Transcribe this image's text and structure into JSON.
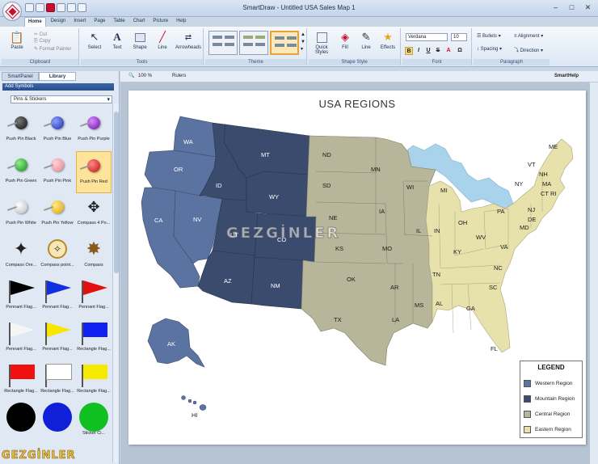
{
  "window": {
    "title": "SmartDraw - Untitled USA Sales Map 1"
  },
  "tabs": [
    "Home",
    "Design",
    "Insert",
    "Page",
    "Table",
    "Chart",
    "Picture",
    "Help"
  ],
  "ribbon": {
    "clipboard": {
      "paste": "Paste",
      "cut": "Cut",
      "copy": "Copy",
      "format_painter": "Format Painter",
      "label": "Clipboard"
    },
    "tools": {
      "select": "Select",
      "text": "Text",
      "shape": "Shape",
      "line": "Line",
      "arrowheads": "Arrowheads",
      "label": "Tools"
    },
    "theme": {
      "label": "Theme"
    },
    "shape_style": {
      "quick_styles": "Quick Styles",
      "fill": "Fill",
      "line": "Line",
      "effects": "Effects",
      "label": "Shape Style"
    },
    "font": {
      "family": "Verdana",
      "size": "10",
      "label": "Font",
      "bold": "B",
      "italic": "I",
      "underline": "U",
      "strike": "S",
      "fontcolor": "A",
      "omega": "Ω"
    },
    "paragraph": {
      "bullets": "Bullets",
      "alignment": "Alignment",
      "spacing": "Spacing",
      "direction": "Direction",
      "label": "Paragraph"
    }
  },
  "panel": {
    "tabs": [
      "SmartPanel",
      "Library"
    ],
    "add_symbols": "Add Symbols",
    "library": "Pins & Stickers",
    "symbols": [
      "Push Pin Black",
      "Push Pin Blue",
      "Push Pin Purple",
      "Push Pin Green",
      "Push Pin Pink",
      "Push Pin Red",
      "Push Pin White",
      "Push Pin Yellow",
      "Compass 4 Po...",
      "Compass Ore...",
      "Compass point...",
      "Compass",
      "Pennant Flag...",
      "Pennant Flag...",
      "Pennant Flag...",
      "Pennant Flag...",
      "Pennant Flag...",
      "Rectangle Flag...",
      "Rectangle Flag...",
      "Rectangle Flag...",
      "Rectangle Flag...",
      "",
      "",
      "Sticker Ci..."
    ]
  },
  "canvas_toolbar": {
    "zoom": "100 %",
    "rulers": "Rulers",
    "smarthelp": "SmartHelp"
  },
  "map": {
    "title": "USA REGIONS",
    "states": {
      "WA": "WA",
      "OR": "OR",
      "CA": "CA",
      "NV": "NV",
      "ID": "ID",
      "MT": "MT",
      "WY": "WY",
      "UT": "UT",
      "CO": "CO",
      "AZ": "AZ",
      "NM": "NM",
      "ND": "ND",
      "SD": "SD",
      "NE": "NE",
      "KS": "KS",
      "OK": "OK",
      "TX": "TX",
      "MN": "MN",
      "IA": "IA",
      "MO": "MO",
      "AR": "AR",
      "LA": "LA",
      "WI": "WI",
      "IL": "IL",
      "MS": "MS",
      "MI": "MI",
      "IN": "IN",
      "OH": "OH",
      "KY": "KY",
      "TN": "TN",
      "AL": "AL",
      "GA": "GA",
      "FL": "FL",
      "SC": "SC",
      "NC": "NC",
      "VA": "VA",
      "WV": "WV",
      "PA": "PA",
      "NY": "NY",
      "VT": "VT",
      "NH": "NH",
      "ME": "ME",
      "MA": "MA",
      "CT": "CT",
      "RI": "RI",
      "NJ": "NJ",
      "DE": "DE",
      "MD": "MD",
      "AK": "AK",
      "HI": "HI"
    },
    "colors": {
      "western": "#5b73a0",
      "mountain": "#3b4b6e",
      "central": "#b7b59a",
      "eastern": "#e7e2ac",
      "water": "#a9d3ea"
    }
  },
  "legend": {
    "title": "LEGEND",
    "items": [
      {
        "label": "Western Region",
        "color": "#5b73a0"
      },
      {
        "label": "Mountain Region",
        "color": "#3b4b6e"
      },
      {
        "label": "Central Region",
        "color": "#b7b59a"
      },
      {
        "label": "Eastern Region",
        "color": "#e7e2ac"
      }
    ]
  },
  "watermark": "GEZGİNLER",
  "watermark_corner": "GEZGİNLER"
}
